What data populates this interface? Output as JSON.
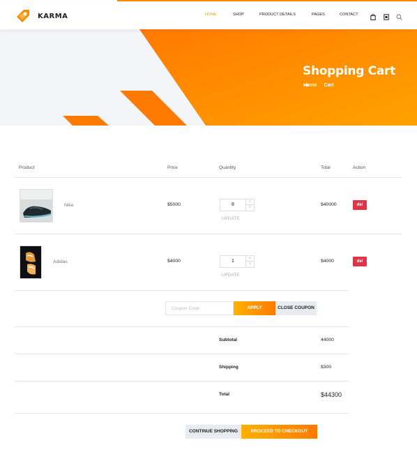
{
  "brand": {
    "name": "KARMA"
  },
  "nav": {
    "items": [
      {
        "label": "HOME",
        "active": true
      },
      {
        "label": "SHOP",
        "active": false
      },
      {
        "label": "PRODUCT DETAILS",
        "active": false
      },
      {
        "label": "PAGES",
        "active": false
      },
      {
        "label": "CONTACT",
        "active": false
      }
    ],
    "icons": [
      "bag-icon",
      "card-icon",
      "search-icon"
    ]
  },
  "banner": {
    "title": "Shopping Cart",
    "breadcrumb": [
      "Home",
      "Cart"
    ]
  },
  "cart": {
    "columns": [
      "Product",
      "Price",
      "Quantity",
      "Total",
      "Action"
    ],
    "rows": [
      {
        "product": "Nike",
        "price": "$5000",
        "quantity": "8",
        "update_label": "UPDATE",
        "total": "$40000",
        "action": "del"
      },
      {
        "product": "Adidas",
        "price": "$4000",
        "quantity": "1",
        "update_label": "UPDATE",
        "total": "$4000",
        "action": "del"
      }
    ],
    "coupon": {
      "placeholder": "Coupon Code",
      "apply_label": "APPLY",
      "close_label": "CLOSE COUPON"
    },
    "totals": {
      "subtotal_label": "Subtotal",
      "subtotal": "44000",
      "shipping_label": "Shipping",
      "shipping": "$300",
      "total_label": "Total",
      "total": "$44300"
    },
    "continue_label": "CONTINUE SHOPPING",
    "checkout_label": "PROCEED TO CHECKOUT"
  },
  "colors": {
    "accent": "#ff9d00",
    "accent_dark": "#ff7a00",
    "danger": "#e03546"
  }
}
